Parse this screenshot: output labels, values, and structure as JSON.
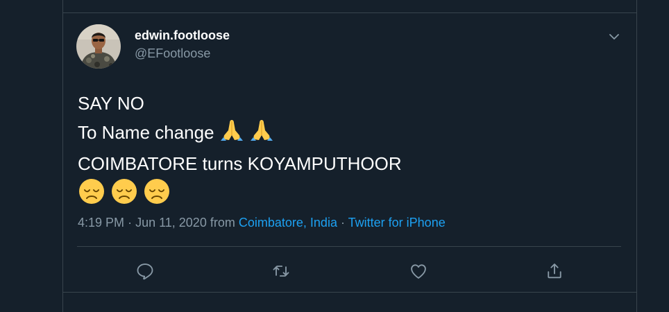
{
  "tweet": {
    "display_name": "edwin.footloose",
    "handle": "@EFootloose",
    "lines": [
      "SAY NO",
      "To Name change",
      "COIMBATORE turns KOYAMPUTHOOR"
    ],
    "emojis": {
      "line2": [
        "folded-hands",
        "folded-hands"
      ],
      "line4": [
        "disappointed-face",
        "disappointed-face",
        "disappointed-face"
      ]
    },
    "time": "4:19 PM",
    "date": "Jun 11, 2020",
    "from_label": "from",
    "location": "Coimbatore, India",
    "source": "Twitter for iPhone",
    "separator": "·"
  },
  "actions": [
    "reply-icon",
    "retweet-icon",
    "like-icon",
    "share-icon"
  ],
  "colors": {
    "background": "#15202b",
    "border": "#38444d",
    "text_primary": "#ffffff",
    "text_secondary": "#8899a6",
    "link": "#1da1f2"
  }
}
